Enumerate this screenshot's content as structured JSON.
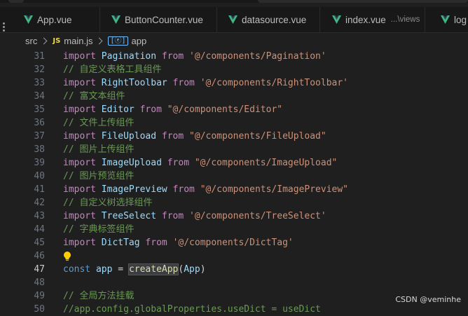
{
  "tabs": [
    {
      "label": "App.vue",
      "icon": "vue-icon"
    },
    {
      "label": "ButtonCounter.vue",
      "icon": "vue-icon"
    },
    {
      "label": "datasource.vue",
      "icon": "vue-icon"
    },
    {
      "label": "index.vue",
      "hint": "...\\views",
      "icon": "vue-icon"
    },
    {
      "label": "log",
      "icon": "vue-icon"
    }
  ],
  "breadcrumb": {
    "folder": "src",
    "file_badge": "JS",
    "file": "main.js",
    "symbol_badge": "[ⓔ]",
    "symbol": "app"
  },
  "editor": {
    "active_line": 47,
    "lines": [
      {
        "n": "31",
        "kw": "import",
        "name": "Pagination",
        "from": "from",
        "path": "'@/components/Pagination'"
      },
      {
        "n": "32",
        "comment": "// 自定义表格工具组件"
      },
      {
        "n": "33",
        "kw": "import",
        "name": "RightToolbar",
        "from": "from",
        "path": "'@/components/RightToolbar'"
      },
      {
        "n": "34",
        "comment": "// 富文本组件"
      },
      {
        "n": "35",
        "kw": "import",
        "name": "Editor",
        "from": "from",
        "path": "\"@/components/Editor\""
      },
      {
        "n": "36",
        "comment": "// 文件上传组件"
      },
      {
        "n": "37",
        "kw": "import",
        "name": "FileUpload",
        "from": "from",
        "path": "\"@/components/FileUpload\""
      },
      {
        "n": "38",
        "comment": "// 图片上传组件"
      },
      {
        "n": "39",
        "kw": "import",
        "name": "ImageUpload",
        "from": "from",
        "path": "\"@/components/ImageUpload\""
      },
      {
        "n": "40",
        "comment": "// 图片预览组件"
      },
      {
        "n": "41",
        "kw": "import",
        "name": "ImagePreview",
        "from": "from",
        "path": "\"@/components/ImagePreview\""
      },
      {
        "n": "42",
        "comment": "// 自定义树选择组件"
      },
      {
        "n": "43",
        "kw": "import",
        "name": "TreeSelect",
        "from": "from",
        "path": "'@/components/TreeSelect'"
      },
      {
        "n": "44",
        "comment": "// 字典标签组件"
      },
      {
        "n": "45",
        "kw": "import",
        "name": "DictTag",
        "from": "from",
        "path": "'@/components/DictTag'"
      },
      {
        "n": "46",
        "lightbulb": "lightbulb-icon"
      },
      {
        "n": "47",
        "decl": "const",
        "var": "app",
        "eq": "=",
        "call": "createApp",
        "paren_open": "(",
        "arg": "App",
        "paren_close": ")"
      },
      {
        "n": "48"
      },
      {
        "n": "49",
        "comment": "// 全局方法挂载"
      },
      {
        "n": "50",
        "comment": "//app.config.globalProperties.useDict = useDict"
      }
    ]
  },
  "watermark": "CSDN @veminhe",
  "colors": {
    "keyword": "#c586c0",
    "identifier": "#9cdcfe",
    "string": "#ce9178",
    "comment": "#6a9955",
    "function": "#dcdcaa",
    "storage": "#569cd6",
    "vue_green": "#41b883"
  }
}
